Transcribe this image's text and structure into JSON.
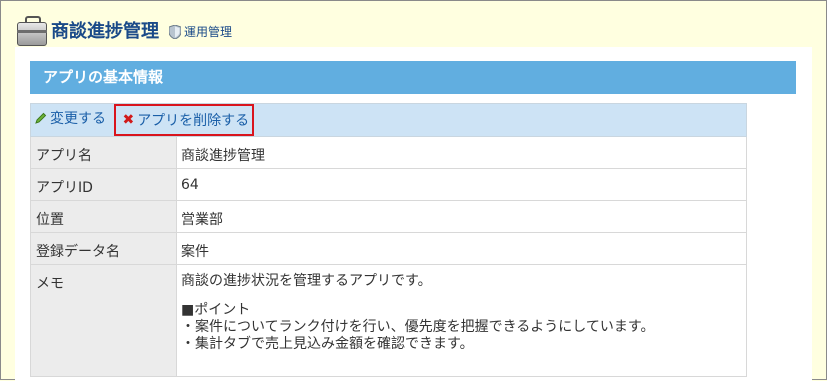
{
  "header": {
    "title": "商談進捗管理",
    "badge": "運用管理"
  },
  "section": {
    "title": "アプリの基本情報"
  },
  "toolbar": {
    "edit_label": "変更する",
    "delete_label": "アプリを削除する"
  },
  "fields": {
    "app_name": {
      "label": "アプリ名",
      "value": "商談進捗管理"
    },
    "app_id": {
      "label": "アプリID",
      "value": "64"
    },
    "location": {
      "label": "位置",
      "value": "営業部"
    },
    "data_name": {
      "label": "登録データ名",
      "value": "案件"
    },
    "memo": {
      "label": "メモ",
      "line1": "商談の進捗状況を管理するアプリです。",
      "line2": "■ポイント",
      "line3": "・案件についてランク付けを行い、優先度を把握できるようにしています。",
      "line4": "・集計タブで売上見込み金額を確認できます。"
    }
  },
  "colors": {
    "section_bar": "#61aee0",
    "toolbar": "#cde3f5",
    "delete_highlight": "#d9141d",
    "page_bg": "#ffffe0"
  },
  "icons": {
    "app": "briefcase-icon",
    "badge": "shield-icon",
    "edit": "pencil-icon",
    "delete": "close-icon"
  }
}
